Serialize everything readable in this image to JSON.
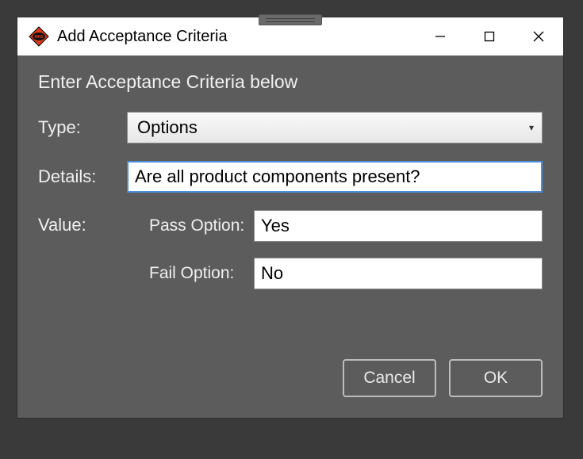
{
  "window": {
    "title": "Add Acceptance Criteria",
    "app_icon": "mrs-diamond-icon"
  },
  "form": {
    "heading": "Enter Acceptance Criteria below",
    "type_label": "Type:",
    "type_value": "Options",
    "details_label": "Details:",
    "details_value": "Are all product components present?",
    "value_label": "Value:",
    "pass_label": "Pass Option:",
    "pass_value": "Yes",
    "fail_label": "Fail Option:",
    "fail_value": "No"
  },
  "buttons": {
    "cancel": "Cancel",
    "ok": "OK"
  }
}
